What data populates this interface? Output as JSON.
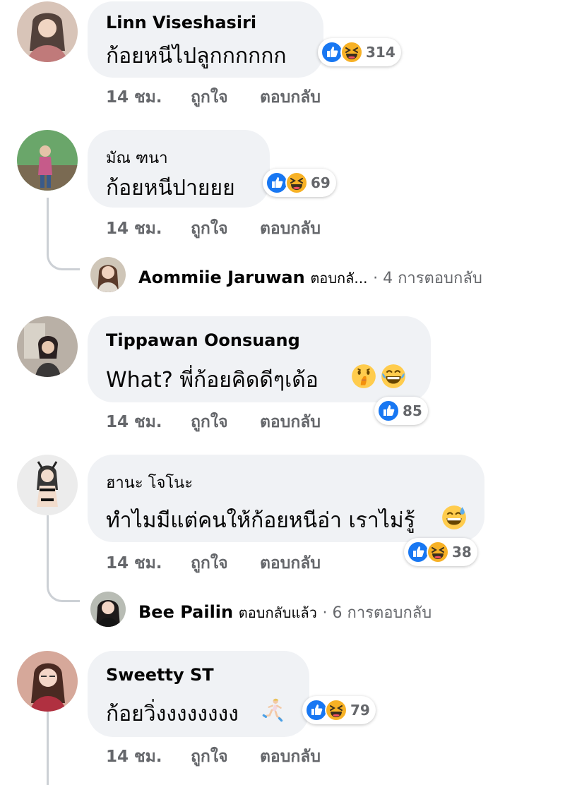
{
  "comments": [
    {
      "name": "Linn Viseshasiri",
      "text": "ก้อยหนีไปลูกกกกกก",
      "reaction_count": "314",
      "time": "14 ชม.",
      "like_label": "ถูกใจ",
      "reply_label": "ตอบกลับ",
      "reactions": [
        "like-icon",
        "haha-icon"
      ]
    },
    {
      "name": "มัณ ฑนา",
      "text": "ก้อยหนีปายยย",
      "reaction_count": "69",
      "time": "14 ชม.",
      "like_label": "ถูกใจ",
      "reply_label": "ตอบกลับ",
      "reactions": [
        "like-icon",
        "haha-icon"
      ],
      "reply_preview": {
        "name": "Aommiie Jaruwan",
        "action": "ตอบกลั...",
        "count": "· 4 การตอบกลับ"
      }
    },
    {
      "name": "Tippawan Oonsuang",
      "text": "What? พี่ก้อยคิดดีๆเด้อ",
      "emojis": [
        "shushing-face-icon",
        "laughing-tears-icon"
      ],
      "reaction_count": "85",
      "time": "14 ชม.",
      "like_label": "ถูกใจ",
      "reply_label": "ตอบกลับ",
      "reactions": [
        "like-icon"
      ]
    },
    {
      "name": "ฮานะ โจโนะ",
      "text": "ทำไมมีแต่คนให้ก้อยหนีอ่า เราไม่รู้",
      "emojis": [
        "sweat-smile-icon"
      ],
      "reaction_count": "38",
      "time": "14 ชม.",
      "like_label": "ถูกใจ",
      "reply_label": "ตอบกลับ",
      "reactions": [
        "like-icon",
        "haha-icon"
      ],
      "reply_preview": {
        "name": "Bee Pailin",
        "action": "ตอบกลับแล้ว",
        "count": "· 6 การตอบกลับ"
      }
    },
    {
      "name": "Sweetty ST",
      "text": "ก้อยวิ่งงงงงงงง",
      "emojis": [
        "running-woman-icon"
      ],
      "reaction_count": "79",
      "time": "14 ชม.",
      "like_label": "ถูกใจ",
      "reply_label": "ตอบกลับ",
      "reactions": [
        "like-icon",
        "haha-icon"
      ]
    }
  ],
  "colors": {
    "bubble": "#f0f2f5",
    "meta": "#65676b",
    "like": "#1877f2",
    "haha": "#f7b125",
    "thread": "#ccd0d5"
  }
}
